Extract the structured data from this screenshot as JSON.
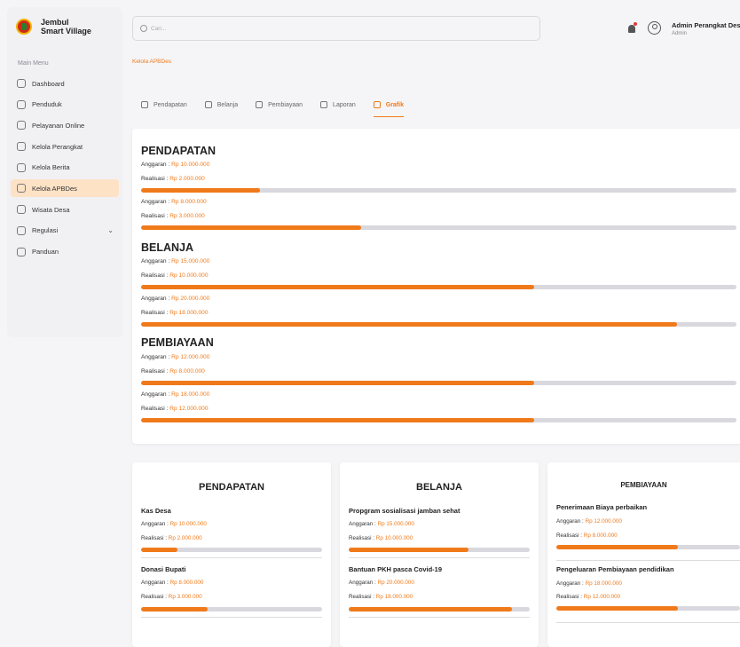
{
  "brand": {
    "line1": "Jembul",
    "line2": "Smart Village"
  },
  "sidebar": {
    "menu_title": "Main Menu",
    "items": [
      {
        "label": "Dashboard",
        "icon": "grid-icon"
      },
      {
        "label": "Penduduk",
        "icon": "users-icon"
      },
      {
        "label": "Pelayanan Online",
        "icon": "globe-icon"
      },
      {
        "label": "Kelola Perangkat",
        "icon": "id-card-icon"
      },
      {
        "label": "Kelola Berita",
        "icon": "edit-icon"
      },
      {
        "label": "Kelola APBDes",
        "icon": "dollar-circle-icon",
        "active": true
      },
      {
        "label": "Wisata Desa",
        "icon": "image-icon"
      },
      {
        "label": "Regulasi",
        "icon": "document-icon"
      },
      {
        "label": "Panduan",
        "icon": "book-icon"
      }
    ]
  },
  "header": {
    "search_placeholder": "Cari...",
    "user_name": "Admin Perangkat Desa",
    "user_role": "Admin"
  },
  "breadcrumb": "Kelola APBDes",
  "tabs": [
    {
      "label": "Pendapatan",
      "icon": "dollar-circle-icon"
    },
    {
      "label": "Belanja",
      "icon": "shopping-bag-icon"
    },
    {
      "label": "Pembiayaan",
      "icon": "wallet-icon"
    },
    {
      "label": "Laporan",
      "icon": "report-icon"
    },
    {
      "label": "Grafik",
      "icon": "bar-chart-icon",
      "active": true
    }
  ],
  "labels": {
    "anggaran": "Anggaran : ",
    "realisasi": "Realisasi : "
  },
  "summary": [
    {
      "title": "PENDAPATAN",
      "rows": [
        {
          "anggaran": "Rp 10.000.000",
          "realisasi": "Rp 2.000.000",
          "progress": 0.2
        },
        {
          "anggaran": "Rp 8.000.000",
          "realisasi": "Rp 3.000.000",
          "progress": 0.37
        }
      ]
    },
    {
      "title": "BELANJA",
      "rows": [
        {
          "anggaran": "Rp 15.000.000",
          "realisasi": "Rp 10.000.000",
          "progress": 0.66
        },
        {
          "anggaran": "Rp 20.000.000",
          "realisasi": "Rp 18.000.000",
          "progress": 0.9
        }
      ]
    },
    {
      "title": "PEMBIAYAAN",
      "rows": [
        {
          "anggaran": "Rp 12.000.000",
          "realisasi": "Rp 8.000.000",
          "progress": 0.66
        },
        {
          "anggaran": "Rp 18.000.000",
          "realisasi": "Rp 12.000.000",
          "progress": 0.66
        }
      ]
    }
  ],
  "detail_cards": [
    {
      "title": "PENDAPATAN",
      "items": [
        {
          "name": "Kas Desa",
          "anggaran": "Rp 10.000.000",
          "realisasi": "Rp 2.000.000",
          "progress": 0.2
        },
        {
          "name": "Donasi Bupati",
          "anggaran": "Rp 8.000.000",
          "realisasi": "Rp 3.000.000",
          "progress": 0.37
        }
      ]
    },
    {
      "title": "BELANJA",
      "items": [
        {
          "name": "Propgram sosialisasi jamban sehat",
          "anggaran": "Rp 15.000.000",
          "realisasi": "Rp 10.000.000",
          "progress": 0.66
        },
        {
          "name": "Bantuan PKH pasca Covid-19",
          "anggaran": "Rp 20.000.000",
          "realisasi": "Rp 18.000.000",
          "progress": 0.9
        }
      ]
    },
    {
      "title": "PEMBIAYAAN",
      "items": [
        {
          "name": "Penerimaan Biaya perbaikan",
          "anggaran": "Rp 12.000.000",
          "realisasi": "Rp 8.000.000",
          "progress": 0.66
        },
        {
          "name": "Pengeluaran Pembiayaan pendidikan",
          "anggaran": "Rp 18.000.000",
          "realisasi": "Rp 12.000.000",
          "progress": 0.66
        }
      ]
    }
  ],
  "colors": {
    "accent": "#f07a1a",
    "track": "#d8d8de",
    "active_menu_bg": "#fde2c6"
  }
}
